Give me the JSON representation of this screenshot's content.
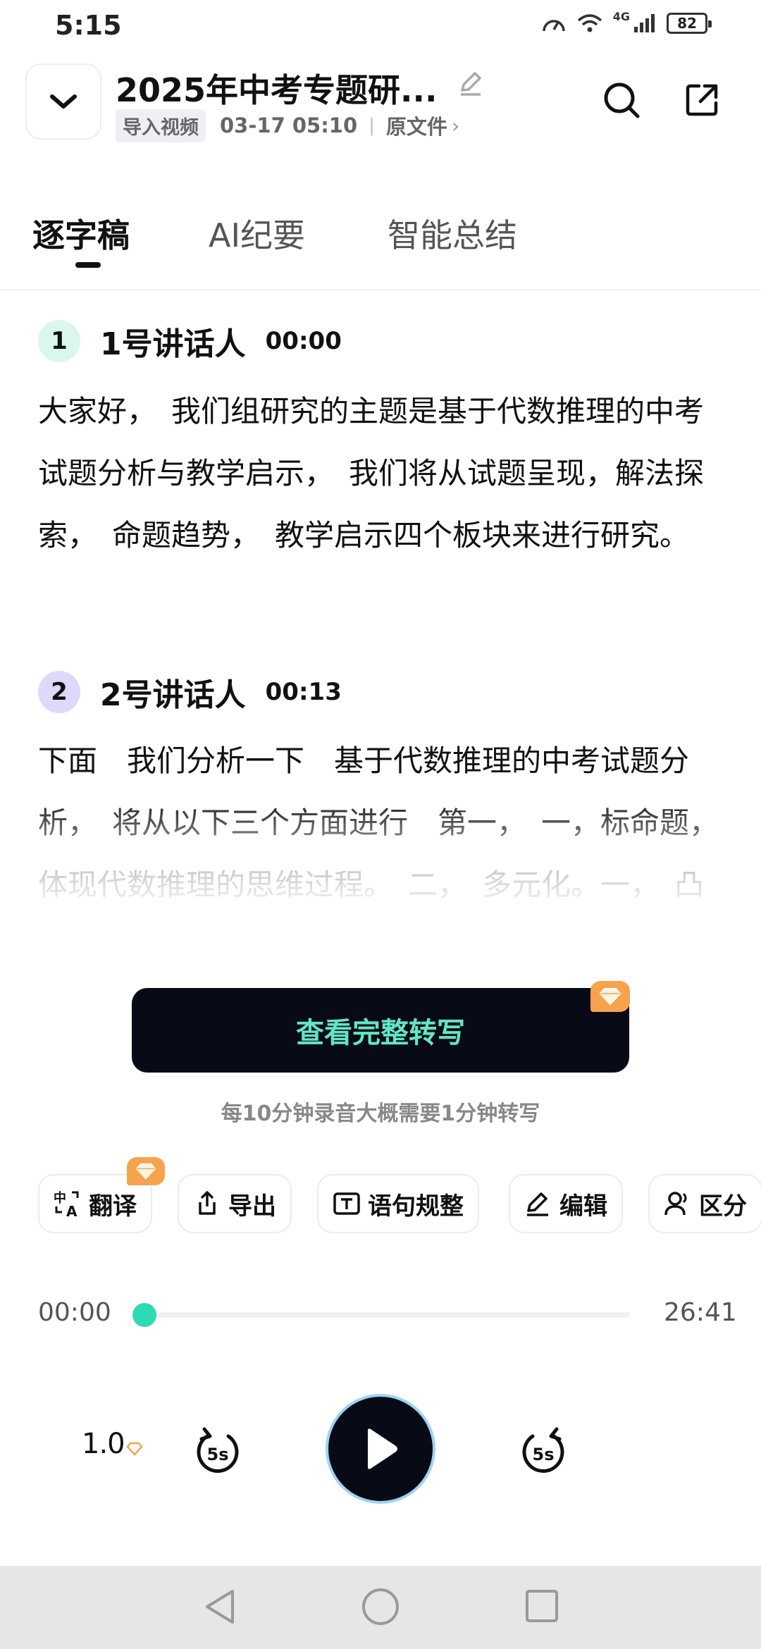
{
  "status": {
    "time": "5:15",
    "network": "4G",
    "battery": "82"
  },
  "header": {
    "title": "2025年中考专题研...",
    "source_tag": "导入视频",
    "timestamp": "03-17 05:10",
    "separator": "|",
    "file_link": "原文件",
    "icons": [
      "chevron-down-icon",
      "pencil-icon",
      "search-icon",
      "share-icon"
    ]
  },
  "tabs": [
    {
      "label": "逐字稿",
      "active": true
    },
    {
      "label": "AI纪要",
      "active": false
    },
    {
      "label": "智能总结",
      "active": false
    }
  ],
  "transcript": [
    {
      "number": "1",
      "speaker": "1号讲话人",
      "time": "00:00",
      "avatar_color": "#d9f7ee",
      "text": "大家好，　我们组研究的主题是基于代数推理的中考试题分析与教学启示，　我们将从试题呈现，解法探索，　命题趋势，　教学启示四个板块来进行研究。"
    },
    {
      "number": "2",
      "speaker": "2号讲话人",
      "time": "00:13",
      "avatar_color": "#dcd9fb",
      "text": "下面　我们分析一下　基于代数推理的中考试题分析，　将从以下三个方面进行　第一，　一，标命题，体现代数推理的思维过程。　二，　多元化。一，　凸显代数推理的主要思想，　三，　数形结"
    }
  ],
  "full_transcript": {
    "button_label": "查看完整转写",
    "hint": "每10分钟录音大概需要1分钟转写"
  },
  "tools": [
    {
      "label": "翻译",
      "icon": "translate-icon"
    },
    {
      "label": "导出",
      "icon": "export-icon"
    },
    {
      "label": "语句规整",
      "icon": "text-format-icon"
    },
    {
      "label": "编辑",
      "icon": "edit-icon"
    },
    {
      "label": "区分",
      "icon": "speaker-distinguish-icon"
    }
  ],
  "player": {
    "current": "00:00",
    "total": "26:41",
    "progress": 0.0,
    "speed": "1.0",
    "rewind_label": "5s",
    "forward_label": "5s",
    "accent": "#2fd9b4"
  },
  "colors": {
    "premium": "#f7a34d",
    "button_bg": "#080b16",
    "button_text": "#63e5c7"
  }
}
